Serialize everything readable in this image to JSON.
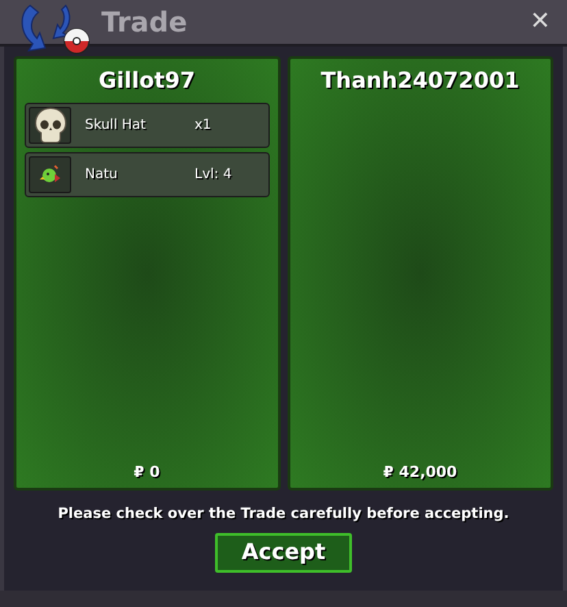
{
  "window": {
    "title": "Trade",
    "close": "✕"
  },
  "panels": [
    {
      "name": "Gillot97",
      "items": [
        {
          "kind": "hat",
          "name": "Skull Hat",
          "detail": "x1"
        },
        {
          "kind": "pet",
          "name": "Natu",
          "detail": "Lvl: 4"
        }
      ],
      "money": "₽ 0"
    },
    {
      "name": "Thanh24072001",
      "money": "₽ 42,000"
    }
  ],
  "notice": "Please check over the Trade carefully before accepting.",
  "accept_button": "Accept"
}
